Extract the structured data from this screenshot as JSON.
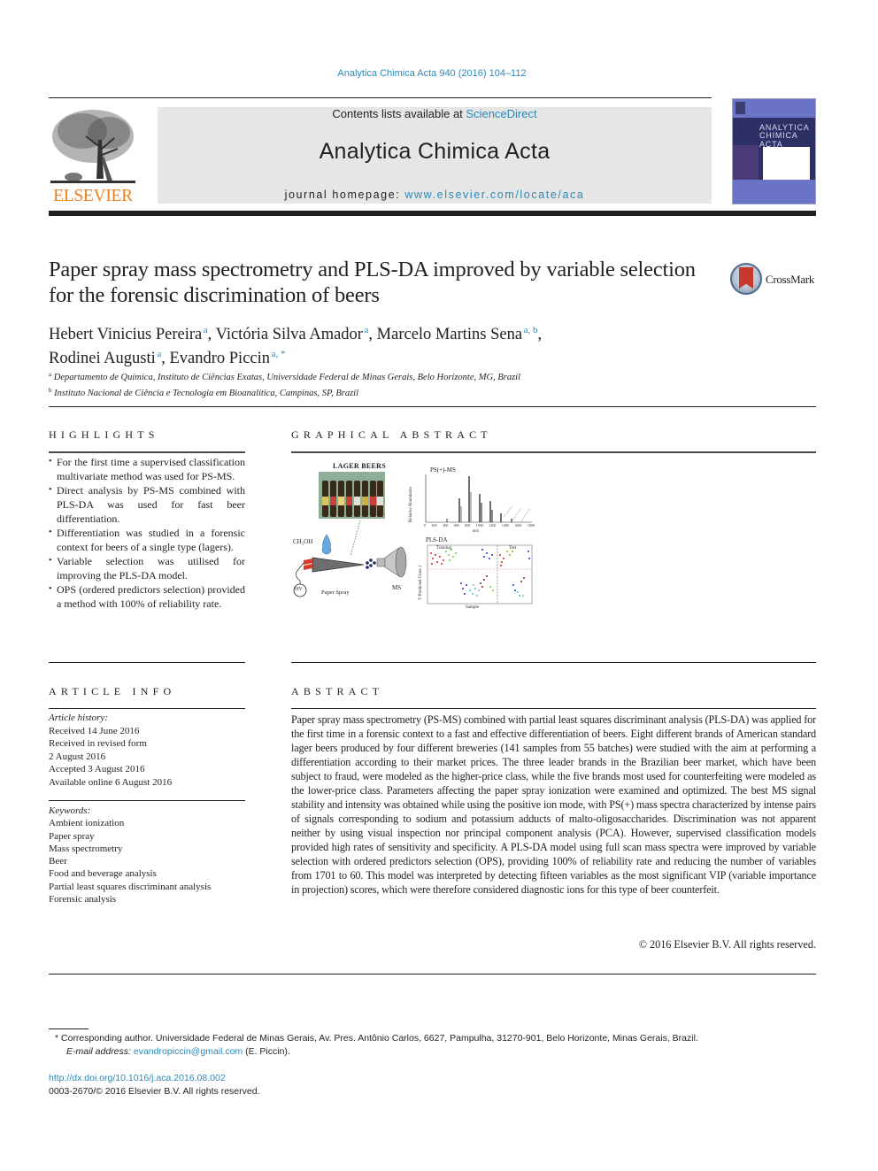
{
  "header": {
    "journal_citation": "Analytica Chimica Acta 940 (2016) 104–112",
    "contents_prefix": "Contents lists available at ",
    "contents_link": "ScienceDirect",
    "journal_title": "Analytica Chimica Acta",
    "homepage_prefix": "journal homepage: ",
    "homepage_link": "www.elsevier.com/locate/aca",
    "publisher_logo": "ELSEVIER",
    "cover_title_line1": "ANALYTICA",
    "cover_title_line2": "CHIMICA ACTA"
  },
  "article": {
    "title": "Paper spray mass spectrometry and PLS-DA improved by variable selection for the forensic discrimination of beers",
    "crossmark_label": "CrossMark",
    "authors": [
      {
        "name": "Hebert Vinicius Pereira",
        "aff": "a",
        "sep": ", "
      },
      {
        "name": "Victória Silva Amador",
        "aff": "a",
        "sep": ", "
      },
      {
        "name": "Marcelo Martins Sena",
        "aff": "a, b",
        "sep": ","
      },
      {
        "name": "Rodinei Augusti",
        "aff": "a",
        "sep": ", "
      },
      {
        "name": "Evandro Piccin",
        "aff": "a, *",
        "sep": ""
      }
    ],
    "affiliations": [
      {
        "key": "a",
        "text": "Departamento de Química, Instituto de Ciências Exatas, Universidade Federal de Minas Gerais, Belo Horizonte, MG, Brazil"
      },
      {
        "key": "b",
        "text": "Instituto Nacional de Ciência e Tecnologia em Bioanalítica, Campinas, SP, Brazil"
      }
    ]
  },
  "highlights": {
    "heading": "HIGHLIGHTS",
    "items": [
      "For the first time a supervised classification multivariate method was used for PS-MS.",
      "Direct analysis by PS-MS combined with PLS-DA was used for fast beer differentiation.",
      "Differentiation was studied in a forensic context for beers of a single type (lagers).",
      "Variable selection was utilised for improving the PLS-DA model.",
      "OPS (ordered predictors selection) provided a method with 100% of reliability rate."
    ]
  },
  "graphical_abstract": {
    "heading": "GRAPHICAL ABSTRACT",
    "labels": {
      "lager_beers": "LAGER BEERS",
      "ms_title": "PS(+)-MS",
      "ms_xlabel": "m/z",
      "ms_ylabel": "Relative Abundance",
      "plsda_title": "PLS-DA",
      "plsda_xlabel": "Sample",
      "plsda_ylabel": "Y Predicted Class 1",
      "training": "Training",
      "test": "Test",
      "methanol": "CH₃OH",
      "hv": "HV",
      "paper_spray": "Paper Spray",
      "ms": "MS"
    },
    "ms_xticks": [
      "0",
      "200",
      "400",
      "600",
      "800",
      "1000",
      "1200",
      "1400",
      "1600",
      "1800"
    ]
  },
  "article_info": {
    "heading": "ARTICLE INFO",
    "history_label": "Article history:",
    "history": [
      "Received 14 June 2016",
      "Received in revised form",
      "2 August 2016",
      "Accepted 3 August 2016",
      "Available online 6 August 2016"
    ],
    "keywords_label": "Keywords:",
    "keywords": [
      "Ambient ionization",
      "Paper spray",
      "Mass spectrometry",
      "Beer",
      "Food and beverage analysis",
      "Partial least squares discriminant analysis",
      "Forensic analysis"
    ]
  },
  "abstract": {
    "heading": "ABSTRACT",
    "text": "Paper spray mass spectrometry (PS-MS) combined with partial least squares discriminant analysis (PLS-DA) was applied for the first time in a forensic context to a fast and effective differentiation of beers. Eight different brands of American standard lager beers produced by four different breweries (141 samples from 55 batches) were studied with the aim at performing a differentiation according to their market prices. The three leader brands in the Brazilian beer market, which have been subject to fraud, were modeled as the higher-price class, while the five brands most used for counterfeiting were modeled as the lower-price class. Parameters affecting the paper spray ionization were examined and optimized. The best MS signal stability and intensity was obtained while using the positive ion mode, with PS(+) mass spectra characterized by intense pairs of signals corresponding to sodium and potassium adducts of malto-oligosaccharides. Discrimination was not apparent neither by using visual inspection nor principal component analysis (PCA). However, supervised classification models provided high rates of sensitivity and specificity. A PLS-DA model using full scan mass spectra were improved by variable selection with ordered predictors selection (OPS), providing 100% of reliability rate and reducing the number of variables from 1701 to 60. This model was interpreted by detecting fifteen variables as the most significant VIP (variable importance in projection) scores, which were therefore considered diagnostic ions for this type of beer counterfeit.",
    "copyright": "© 2016 Elsevier B.V. All rights reserved."
  },
  "footer": {
    "corresponding_mark": "*",
    "corresponding_text": "Corresponding author. Universidade Federal de Minas Gerais, Av. Pres. Antônio Carlos, 6627, Pampulha, 31270-901, Belo Horizonte, Minas Gerais, Brazil.",
    "email_label": "E-mail address:",
    "email": "evandropiccin@gmail.com",
    "email_suffix": " (E. Piccin).",
    "doi": "http://dx.doi.org/10.1016/j.aca.2016.08.002",
    "issn": "0003-2670/© 2016 Elsevier B.V. All rights reserved."
  },
  "colors": {
    "link": "#2a89b8",
    "elsevier_orange": "#f07d1a",
    "masthead_gray": "#e6e6e6",
    "cover_navy": "#2c3065"
  }
}
